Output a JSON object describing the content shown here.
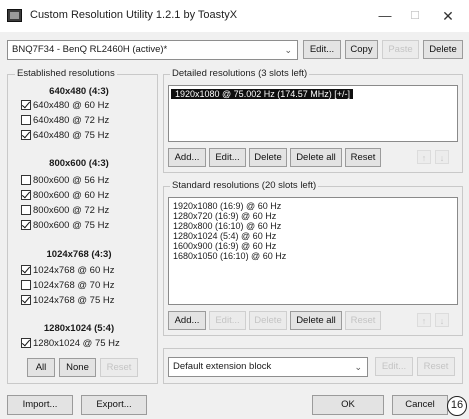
{
  "window": {
    "title": "Custom Resolution Utility 1.2.1 by ToastyX",
    "min_glyph": "—",
    "max_glyph": "☐",
    "close_glyph": "✕"
  },
  "top": {
    "monitor_value": "BNQ7F34 - BenQ RL2460H (active)*",
    "chevron": "⌄",
    "edit": "Edit...",
    "copy": "Copy",
    "paste": "Paste",
    "delete": "Delete"
  },
  "established": {
    "group_label": "Established resolutions",
    "sections": [
      {
        "heading": "640x480 (4:3)",
        "items": [
          {
            "label": "640x480 @ 60 Hz",
            "checked": true
          },
          {
            "label": "640x480 @ 72 Hz",
            "checked": false
          },
          {
            "label": "640x480 @ 75 Hz",
            "checked": true
          }
        ]
      },
      {
        "heading": "800x600 (4:3)",
        "items": [
          {
            "label": "800x600 @ 56 Hz",
            "checked": false
          },
          {
            "label": "800x600 @ 60 Hz",
            "checked": true
          },
          {
            "label": "800x600 @ 72 Hz",
            "checked": false
          },
          {
            "label": "800x600 @ 75 Hz",
            "checked": true
          }
        ]
      },
      {
        "heading": "1024x768 (4:3)",
        "items": [
          {
            "label": "1024x768 @ 60 Hz",
            "checked": true
          },
          {
            "label": "1024x768 @ 70 Hz",
            "checked": false
          },
          {
            "label": "1024x768 @ 75 Hz",
            "checked": true
          }
        ]
      },
      {
        "heading": "1280x1024 (5:4)",
        "items": [
          {
            "label": "1280x1024 @ 75 Hz",
            "checked": true
          }
        ]
      }
    ],
    "all": "All",
    "none": "None",
    "reset": "Reset"
  },
  "detailed": {
    "group_label": "Detailed resolutions (3 slots left)",
    "items": [
      "1920x1080 @ 75.002 Hz (174.57 MHz) [+/-]"
    ],
    "add": "Add...",
    "edit": "Edit...",
    "delete": "Delete",
    "delete_all": "Delete all",
    "reset": "Reset",
    "up": "↑",
    "down": "↓"
  },
  "standard": {
    "group_label": "Standard resolutions (20 slots left)",
    "items": [
      "1920x1080 (16:9) @ 60 Hz",
      "1280x720 (16:9) @ 60 Hz",
      "1280x800 (16:10) @ 60 Hz",
      "1280x1024 (5:4) @ 60 Hz",
      "1600x900 (16:9) @ 60 Hz",
      "1680x1050 (16:10) @ 60 Hz"
    ],
    "add": "Add...",
    "edit": "Edit...",
    "delete": "Delete",
    "delete_all": "Delete all",
    "reset": "Reset",
    "up": "↑",
    "down": "↓"
  },
  "extension": {
    "value": "Default extension block",
    "chevron": "⌄",
    "edit": "Edit...",
    "reset": "Reset"
  },
  "bottom": {
    "import": "Import...",
    "export": "Export...",
    "ok": "OK",
    "cancel": "Cancel"
  },
  "badge": "16"
}
